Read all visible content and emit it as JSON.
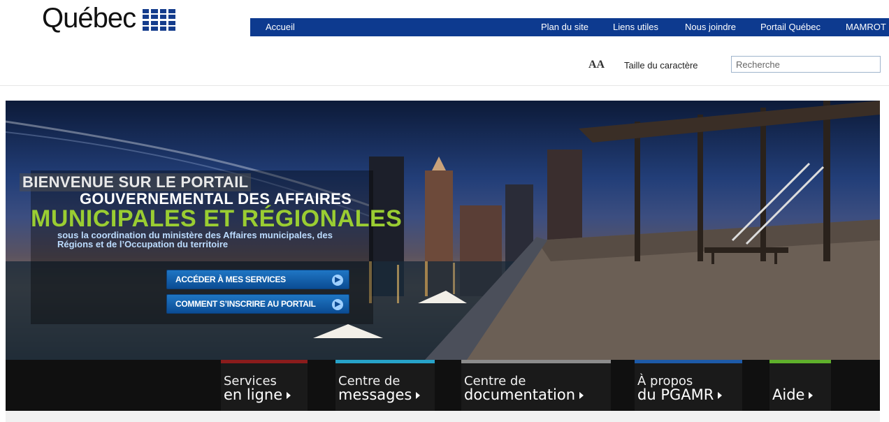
{
  "header": {
    "logo_text": "Québec",
    "nav": [
      "Accueil",
      "Plan du site",
      "Liens utiles",
      "Nous joindre",
      "Portail Québec",
      "MAMROT"
    ],
    "font_size_icon_label": "AA",
    "font_size_label": "Taille du caractère",
    "search_value": "Recherche"
  },
  "hero": {
    "line1": "BIENVENUE SUR LE PORTAIL",
    "line2": "GOUVERNEMENTAL DES AFFAIRES",
    "line3": "MUNICIPALES ET RÉGIONALES",
    "line4": "sous la coordination du ministère des Affaires municipales, des Régions et de l’Occupation du territoire",
    "button1": "ACCÉDER À MES SERVICES",
    "button2": "COMMENT S’INSCRIRE AU PORTAIL"
  },
  "bottom_nav": [
    {
      "line1": "Services",
      "line2": "en ligne",
      "color": "#8b1c1c"
    },
    {
      "line1": "Centre de",
      "line2": "messages",
      "color": "#27a3c9"
    },
    {
      "line1": "Centre de",
      "line2": "documentation",
      "color": "#8c8c8c"
    },
    {
      "line1": "À propos",
      "line2": "du PGAMR",
      "color": "#1d5aa8"
    },
    {
      "line1": "",
      "line2": "Aide",
      "color": "#5fb02b"
    }
  ],
  "colors": {
    "nav_bar": "#0d3a8f",
    "accent_green": "#9acd32"
  }
}
